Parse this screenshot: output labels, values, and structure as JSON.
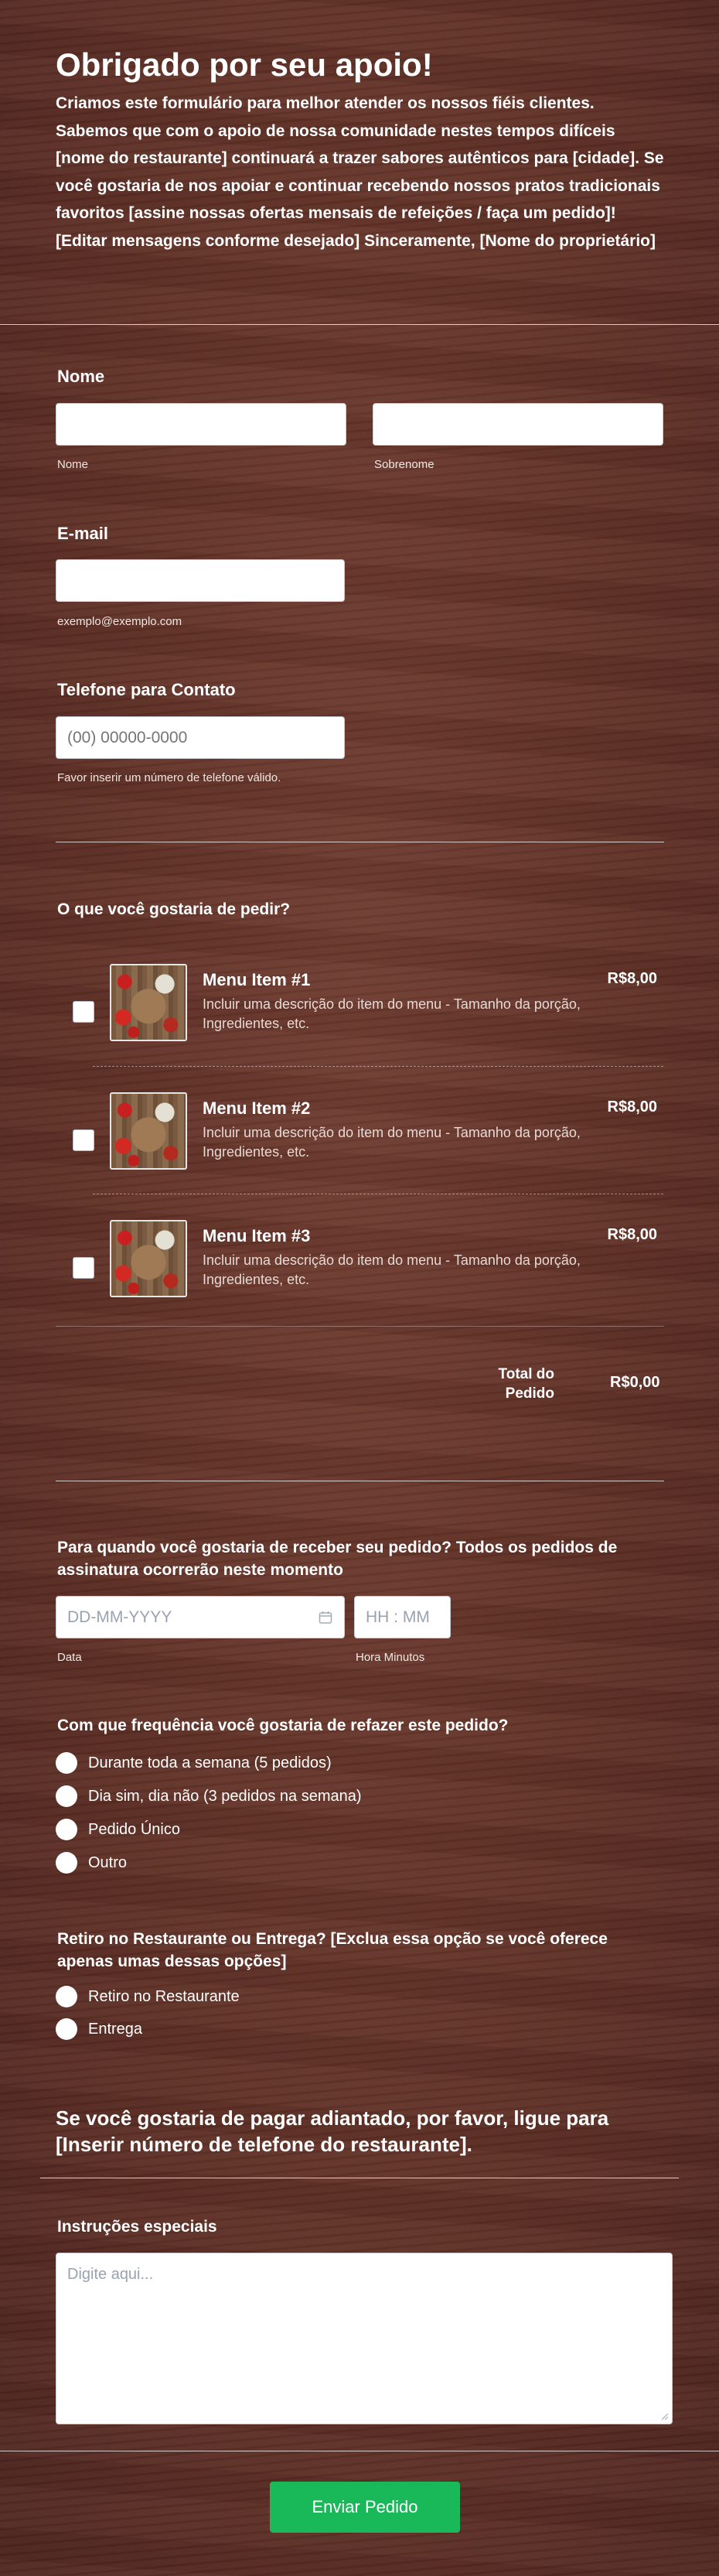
{
  "header": {
    "title": "Obrigado por seu apoio!",
    "text": "Criamos este formulário para melhor atender os nossos fiéis clientes. Sabemos que com o apoio de nossa comunidade nestes tempos difíceis [nome do restaurante] continuará a trazer sabores autênticos para [cidade]. Se você gostaria de nos apoiar e continuar recebendo nossos pratos tradicionais favoritos [assine nossas ofertas mensais de refeições / faça um pedido]! [Editar mensagens conforme desejado] Sinceramente, [Nome do proprietário]"
  },
  "name": {
    "label": "Nome",
    "first_sublabel": "Nome",
    "last_sublabel": "Sobrenome",
    "first_value": "",
    "last_value": ""
  },
  "email": {
    "label": "E-mail",
    "value": "",
    "sublabel": "exemplo@exemplo.com"
  },
  "phone": {
    "label": "Telefone para Contato",
    "placeholder": "(00) 00000-0000",
    "sublabel": "Favor inserir um número de telefone válido."
  },
  "order": {
    "label": "O que você gostaria de pedir?",
    "items": [
      {
        "name": "Menu Item #1",
        "description": "Incluir uma descrição do item do menu - Tamanho da porção, Ingredientes, etc.",
        "price": "R$8,00",
        "checked": false
      },
      {
        "name": "Menu Item #2",
        "description": "Incluir uma descrição do item do menu - Tamanho da porção, Ingredientes, etc.",
        "price": "R$8,00",
        "checked": false
      },
      {
        "name": "Menu Item #3",
        "description": "Incluir uma descrição do item do menu - Tamanho da porção, Ingredientes, etc.",
        "price": "R$8,00",
        "checked": false
      }
    ],
    "total_label_line1": "Total do",
    "total_label_line2": "Pedido",
    "total_value": "R$0,00"
  },
  "delivery_date": {
    "label": "Para quando você gostaria de receber seu pedido? Todos os pedidos de assinatura ocorrerão neste momento",
    "date_placeholder": "DD-MM-YYYY",
    "time_placeholder": "HH : MM",
    "date_sublabel": "Data",
    "time_sublabel": "Hora Minutos"
  },
  "frequency": {
    "label": "Com que frequência você gostaria de refazer este pedido?",
    "options": [
      "Durante toda a semana (5 pedidos)",
      "Dia sim, dia não (3 pedidos na semana)",
      "Pedido Único",
      "Outro"
    ]
  },
  "pickup": {
    "label": "Retiro no Restaurante ou Entrega? [Exclua essa opção se você oferece apenas umas dessas opções]",
    "options": [
      "Retiro no Restaurante",
      "Entrega"
    ]
  },
  "prepay_note": "Se você gostaria de pagar adiantado, por favor, ligue para [Inserir número de telefone do restaurante].",
  "instructions": {
    "label": "Instruções especiais",
    "placeholder": "Digite aqui..."
  },
  "submit_label": "Enviar Pedido",
  "colors": {
    "background": "#5d2e24",
    "submit": "#19b95a"
  }
}
